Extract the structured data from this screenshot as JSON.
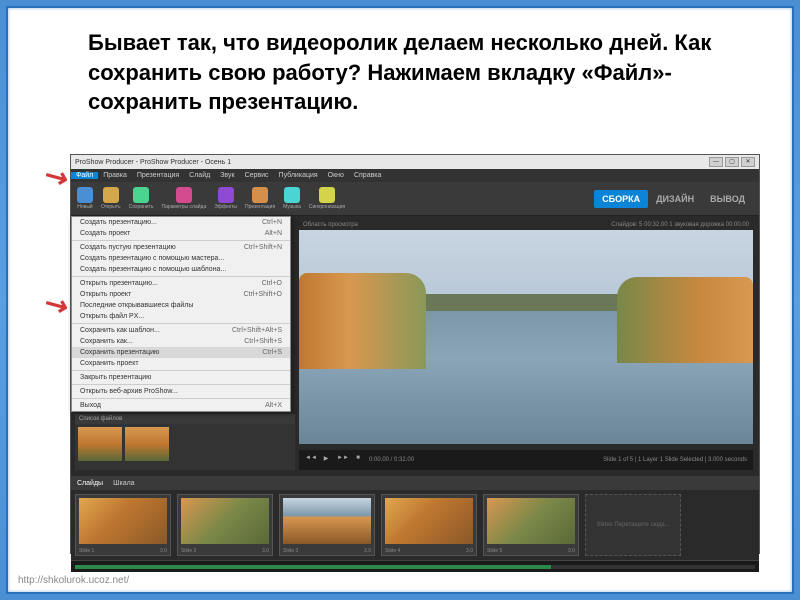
{
  "instruction": "Бывает так, что видеоролик делаем несколько дней. Как сохранить свою работу? Нажимаем вкладку «Файл»- сохранить презентацию.",
  "app": {
    "title": "ProShow Producer - ProShow Producer - Осень 1",
    "menubar": [
      "Файл",
      "Правка",
      "Презентация",
      "Слайд",
      "Звук",
      "Сервис",
      "Публикация",
      "Окно",
      "Справка"
    ],
    "toolbar": [
      {
        "label": "Новый",
        "color": "#4a8fd4"
      },
      {
        "label": "Открыть",
        "color": "#d4a84a"
      },
      {
        "label": "Сохранить",
        "color": "#4ad48f"
      },
      {
        "label": "Параметры слайда",
        "color": "#d44a8f"
      },
      {
        "label": "Эффекты",
        "color": "#8f4ad4"
      },
      {
        "label": "Презентация",
        "color": "#d48f4a"
      },
      {
        "label": "Музыка",
        "color": "#4ad4d4"
      },
      {
        "label": "Синхронизация",
        "color": "#d4d44a"
      }
    ],
    "main_tabs": [
      "СБОРКА",
      "ДИЗАЙН",
      "ВЫВОД"
    ],
    "file_menu": [
      {
        "label": "Создать презентацию...",
        "sc": "Ctrl+N"
      },
      {
        "label": "Создать проект",
        "sc": "Alt+N"
      },
      {
        "sep": true
      },
      {
        "label": "Создать пустую презентацию",
        "sc": "Ctrl+Shift+N"
      },
      {
        "label": "Создать презентацию с помощью мастера...",
        "sc": ""
      },
      {
        "label": "Создать презентацию с помощью шаблона...",
        "sc": ""
      },
      {
        "sep": true
      },
      {
        "label": "Открыть презентацию...",
        "sc": "Ctrl+O"
      },
      {
        "label": "Открыть проект",
        "sc": "Ctrl+Shift+O"
      },
      {
        "label": "Последние открывавшиеся файлы",
        "sc": ""
      },
      {
        "label": "Открыть файл PX...",
        "sc": ""
      },
      {
        "sep": true
      },
      {
        "label": "Сохранить как шаблон...",
        "sc": "Ctrl+Shift+Alt+S"
      },
      {
        "label": "Сохранить как...",
        "sc": "Ctrl+Shift+S"
      },
      {
        "label": "Сохранить презентацию",
        "sc": "Ctrl+S",
        "hl": true
      },
      {
        "label": "Сохранить проект",
        "sc": ""
      },
      {
        "sep": true
      },
      {
        "label": "Закрыть презентацию",
        "sc": ""
      },
      {
        "sep": true
      },
      {
        "label": "Открыть веб-архив ProShow...",
        "sc": ""
      },
      {
        "sep": true
      },
      {
        "label": "Выход",
        "sc": "Alt+X"
      }
    ],
    "preview_header": {
      "left": "Область просмотра",
      "right": "Слайдов: 5  00:32.00  1 звуковая дорожка 00:00.00"
    },
    "filelist_header": "Список файлов",
    "playback": {
      "time": "0:00.00 / 0:32.00",
      "info": "Slide 1 of 5 | 1 Layer\n1 Slide Selected | 3.000 seconds"
    },
    "timeline_tabs": [
      "Слайды",
      "Шкала"
    ],
    "slides": [
      {
        "label": "Slide 1",
        "dur": "3.0",
        "cls": "autumn1"
      },
      {
        "label": "Slide 2",
        "dur": "3.0",
        "cls": "autumn2"
      },
      {
        "label": "Slide 3",
        "dur": "3.0",
        "cls": "autumn3"
      },
      {
        "label": "Slide 4",
        "dur": "3.0",
        "cls": "autumn1"
      },
      {
        "label": "Slide 5",
        "dur": "3.0",
        "cls": "autumn2"
      }
    ],
    "slide_add": "Slides\nПеретащите сюда..."
  },
  "footer": "http://shkolurok.ucoz.net/"
}
